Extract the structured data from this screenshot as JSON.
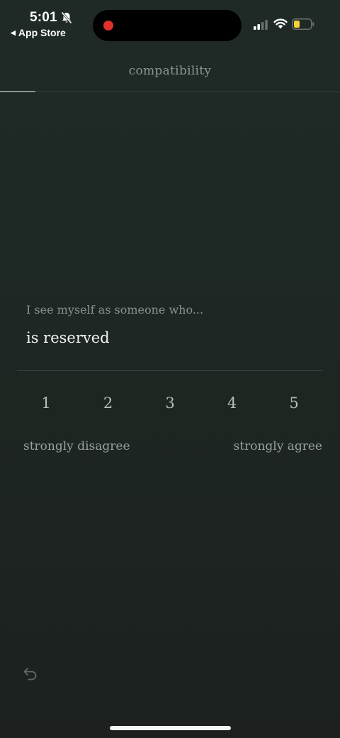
{
  "status_bar": {
    "time": "5:01",
    "back_app": "App Store",
    "back_arrow": "◀",
    "icons": [
      "bell-slash-icon",
      "cellular-signal-icon",
      "wifi-icon",
      "battery-icon"
    ],
    "battery_level": 0.35,
    "battery_color": "#f4d33a",
    "recording_dot_color": "#e0302a"
  },
  "header": {
    "title": "compatibility",
    "progress": 0.104
  },
  "question": {
    "prompt": "I see myself as someone who...",
    "statement": "is reserved"
  },
  "scale": {
    "options": [
      "1",
      "2",
      "3",
      "4",
      "5"
    ],
    "min_label": "strongly disagree",
    "max_label": "strongly agree"
  },
  "footer": {
    "undo_icon": "undo-icon"
  }
}
